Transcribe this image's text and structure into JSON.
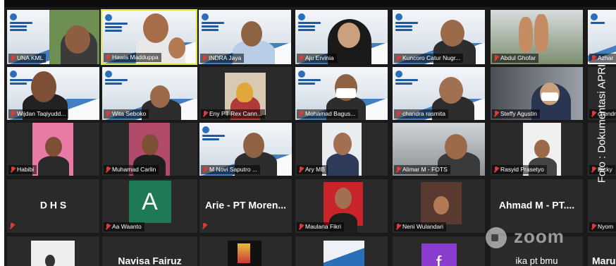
{
  "app": {
    "name": "zoom"
  },
  "watermark": {
    "side_text": "Foto : Dokumentasi APRI"
  },
  "tiles_row1": [
    "UNA KML",
    "Hawis Madduppa",
    "INDRA Jaya",
    "Aju Ervinia",
    "Kuncoro Catur Nugr...",
    "Abdul Ghofar",
    "Azhar"
  ],
  "tiles_row2": [
    "Wijdan Taqiyudd...",
    "Wita Seboko",
    "Eny PT Rex Cann...",
    "Mohamad Bagus...",
    "chandra rasmita",
    "Steffy Agustin",
    "chendra"
  ],
  "tiles_row3": [
    "Habibi",
    "Muhamad Carlin",
    "M Novi Saputro ...",
    "Ary MB",
    "Alimar M - FOTS",
    "Rasyid Prasetyo",
    "Dicky"
  ],
  "tiles_row4": {
    "names": [
      "D H S",
      "Aa Waanto",
      "Arie - PT Moren...",
      "Maulana Fikri",
      "Neni Wulandari",
      "Ahmad M - PT....",
      "Nyom"
    ],
    "avatar_letter": "A"
  },
  "tiles_row5": {
    "names": [
      "",
      "Navisa Fairuz",
      "",
      "",
      "",
      "ika pt bmu",
      "Maru"
    ],
    "avatar_letter": "f"
  },
  "colors": {
    "active_border": "#e1e43a",
    "mic_muted": "#e23a3a",
    "avatar_a": "#1d7a55",
    "avatar_f": "#8a3ccf",
    "brand_blue": "#2a6fb8"
  }
}
